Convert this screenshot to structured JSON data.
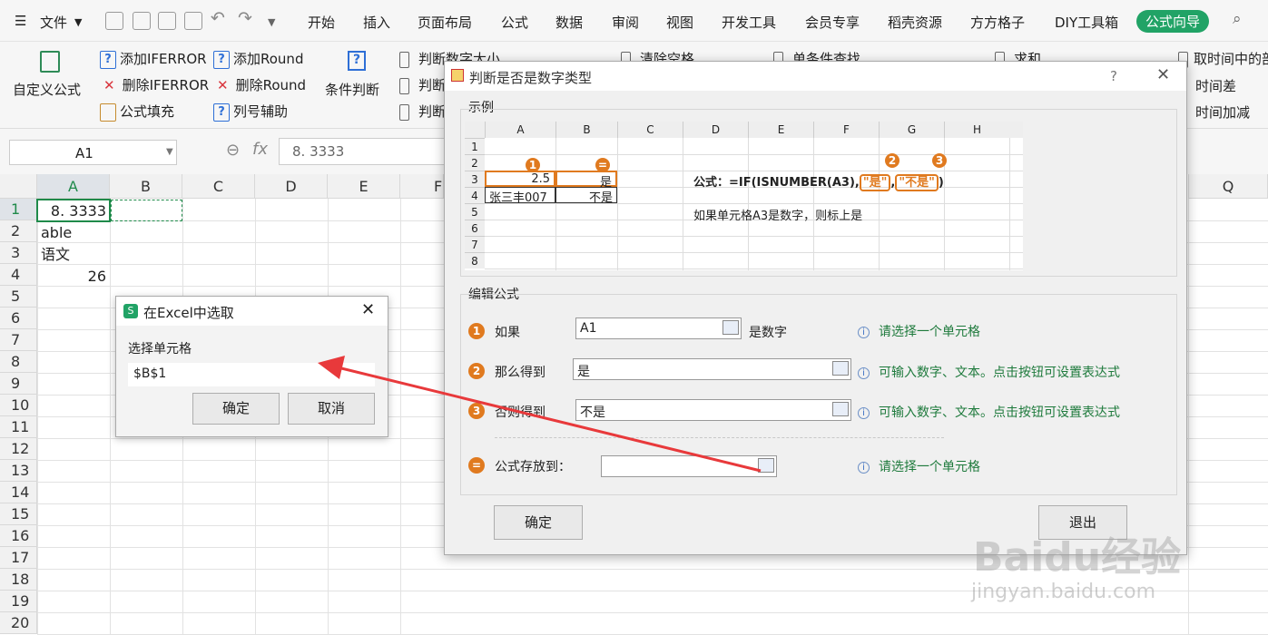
{
  "menu": {
    "file": "文件",
    "tabs": [
      "开始",
      "插入",
      "页面布局",
      "公式",
      "数据",
      "审阅",
      "视图",
      "开发工具",
      "会员专享",
      "稻壳资源",
      "方方格子",
      "DIY工具箱"
    ],
    "active_tab": "公式向导",
    "search": "Q"
  },
  "ribbon": {
    "custom_formula": "自定义公式",
    "add_iferror": "添加IFERROR",
    "del_iferror": "删除IFERROR",
    "formula_fill": "公式填充",
    "add_round": "添加Round",
    "del_round": "删除Round",
    "col_assist": "列号辅助",
    "cond_judge": "条件判断",
    "judge_size": "判断数字大小",
    "judge2": "判断",
    "judge3": "判断",
    "clear_space": "清除空格",
    "single_lookup": "单条件查找",
    "sum": "求和",
    "time_in": "取时间中的部",
    "time_diff": "时间差",
    "time_add": "时间加减"
  },
  "formula_bar": {
    "name_box": "A1",
    "fx": "fx",
    "value": "8. 3333"
  },
  "sheet": {
    "columns": [
      "A",
      "B",
      "C",
      "D",
      "E",
      "F",
      "Q"
    ],
    "rows": [
      "1",
      "2",
      "3",
      "4",
      "5",
      "6",
      "7",
      "8",
      "9",
      "10",
      "11",
      "12",
      "13",
      "14",
      "15",
      "16",
      "17",
      "18",
      "19",
      "20"
    ],
    "cells": {
      "a1": "8. 3333",
      "a2": "able",
      "a3": "语文",
      "a4": "26"
    }
  },
  "popup": {
    "title": "在Excel中选取",
    "label": "选择单元格",
    "value": "$B$1",
    "ok": "确定",
    "cancel": "取消"
  },
  "dialog": {
    "title": "判断是否是数字类型",
    "help": "?",
    "close": "✕",
    "example_label": "示例",
    "example": {
      "cols": [
        "A",
        "B",
        "C",
        "D",
        "E",
        "F",
        "G",
        "H"
      ],
      "rows": [
        "1",
        "2",
        "3",
        "4",
        "5",
        "6",
        "7",
        "8"
      ],
      "a3": "2.5",
      "b3": "是",
      "a4": "张三丰007",
      "b4": "不是",
      "formula_prefix": "公式：=IF(ISNUMBER(A3),",
      "formula_yes": "\"是\"",
      "formula_comma": ",",
      "formula_no": "\"不是\"",
      "formula_end": ")",
      "note": "如果单元格A3是数字，则标上是",
      "n1": "1",
      "n2": "2",
      "n3": "3",
      "neq": "="
    },
    "edit_label": "编辑公式",
    "rows": [
      {
        "num": "1",
        "label": "如果",
        "value": "A1",
        "suffix": "是数字",
        "hint": "请选择一个单元格"
      },
      {
        "num": "2",
        "label": "那么得到",
        "value": "是",
        "hint": "可输入数字、文本。点击按钮可设置表达式"
      },
      {
        "num": "3",
        "label": "否则得到",
        "value": "不是",
        "hint": "可输入数字、文本。点击按钮可设置表达式"
      }
    ],
    "store": {
      "label": "公式存放到：",
      "value": "",
      "hint": "请选择一个单元格"
    },
    "ok": "确定",
    "exit": "退出"
  },
  "watermark": {
    "brand": "Baidu经验",
    "url": "jingyan.baidu.com"
  },
  "colors": {
    "accent": "#21a366",
    "orange": "#e07a1f",
    "arrow": "#e8393b",
    "hint": "#1e7a3c"
  }
}
